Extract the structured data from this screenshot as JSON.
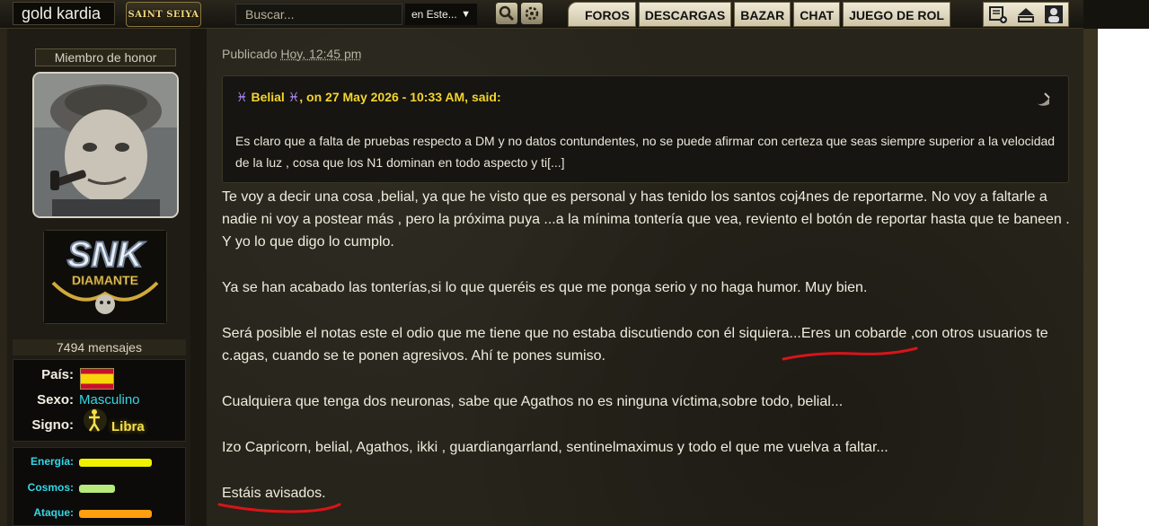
{
  "header": {
    "username": "gold kardia",
    "site_logo": "SAINT SEIYA",
    "search": {
      "placeholder": "Buscar...",
      "scope": "en Este..."
    },
    "nav": [
      "FOROS",
      "DESCARGAS",
      "BAZAR",
      "CHAT",
      "JUEGO DE ROL"
    ],
    "icons": [
      "search-icon",
      "advanced-search-icon",
      "new-post-icon",
      "collapse-icon",
      "profile-icon"
    ]
  },
  "user": {
    "rank": "Miembro de honor",
    "badge": {
      "line1": "SNK",
      "line2": "DIAMANTE"
    },
    "posts": "7494 mensajes",
    "info": {
      "pais_label": "País:",
      "sexo_label": "Sexo:",
      "sexo_value": "Masculino",
      "signo_label": "Signo:",
      "signo_value": "Libra"
    },
    "stats": [
      {
        "label": "Energía:",
        "color": "#f0f000",
        "fill": 0.97
      },
      {
        "label": "Cosmos:",
        "color": "#b6ea7c",
        "fill": 0.48
      },
      {
        "label": "Ataque:",
        "color": "#ff9f10",
        "fill": 0.97
      }
    ]
  },
  "post": {
    "published_prefix": "Publicado",
    "published_time": "Hoy, 12:45 pm",
    "quote": {
      "author": "Belial",
      "suffix": ", on 27 May 2026 - 10:33 AM, said:",
      "text": "Es claro que a falta de pruebas respecto a DM y no datos contundentes, no se puede afirmar con certeza que seas siempre superior a la velocidad de la luz , cosa que los N1 dominan en todo aspecto y ti[...]"
    },
    "paragraphs": [
      "Te voy a decir una cosa ,belial, ya que he visto que es personal y has tenido los santos coj4nes de reportarme. No voy a faltarle a nadie ni voy a postear más , pero la próxima puya ...a la mínima tontería que vea, reviento el botón de reportar hasta que te baneen . Y yo lo que digo lo cumplo.",
      "Ya se han acabado las tonterías,si lo que queréis es que me ponga serio y no haga humor. Muy bien.",
      "Será posible el notas este el odio que me tiene que no estaba discutiendo con él siquiera...Eres un cobarde ,con otros usuarios te c.agas, cuando se te ponen agresivos. Ahí te pones sumiso.",
      "Cualquiera que tenga dos neuronas, sabe que Agathos no es ninguna víctima,sobre todo, belial...",
      "Izo Capricorn, belial, Agathos, ikki , guardiangarrland, sentinelmaximus y todo el que me vuelva a faltar...",
      "Estáis avisados."
    ]
  },
  "colors": {
    "accent_cyan": "#35d6e6",
    "quote_author": "#f4d52c",
    "annotation_red": "#d8141a"
  }
}
